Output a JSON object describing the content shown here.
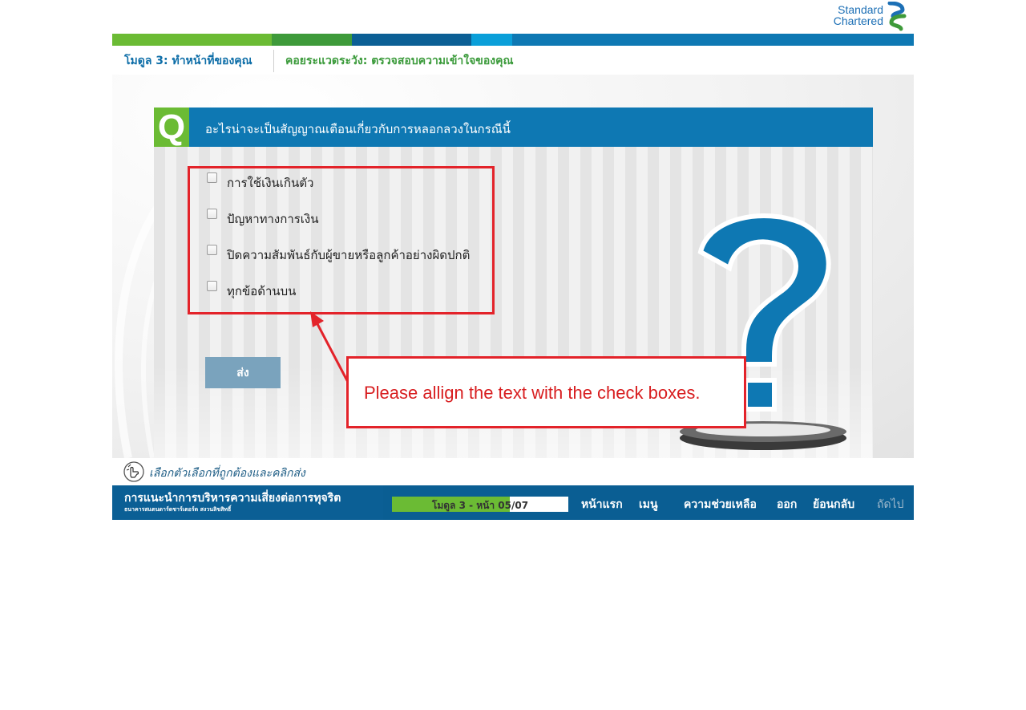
{
  "brand": {
    "line1": "Standard",
    "line2": "Chartered",
    "stripe_colors": [
      "#6bbb34",
      "#3e9a3a",
      "#0b5f95",
      "#0a9fd9",
      "#0e78b3"
    ]
  },
  "header": {
    "module_title": "โมดูล 3: ทำหน้าที่ของคุณ",
    "section_title": "คอยระแวดระวัง: ตรวจสอบความเข้าใจของคุณ"
  },
  "question": {
    "badge": "Q",
    "text": "อะไรน่าจะเป็นสัญญาณเตือนเกี่ยวกับการหลอกลวงในกรณีนี้",
    "options": [
      "การใช้เงินเกินตัว",
      "ปัญหาทางการเงิน",
      "ปิดความสัมพันธ์กับผู้ขายหรือลูกค้าอย่างผิดปกติ",
      "ทุกข้อด้านบน"
    ],
    "submit_label": "ส่ง"
  },
  "annotation": {
    "text": "Please allign the text with the check boxes."
  },
  "hint": {
    "text": "เลือกตัวเลือกที่ถูกต้องและคลิกส่ง"
  },
  "footer": {
    "course_title": "การแนะนำการบริหารความเสี่ยงต่อการทุจริต",
    "course_sub": "ธนาคารสแตนดาร์ดชาร์เตอร์ด สงวนลิขสิทธิ์",
    "progress_label": "โมดูล 3 - หน้า 05/07",
    "progress_fraction": 0.67,
    "nav": {
      "home": "หน้าแรก",
      "menu": "เมนู",
      "help": "ความช่วยเหลือ",
      "exit": "ออก",
      "back": "ย้อนกลับ",
      "next": "ถัดไป"
    }
  },
  "colors": {
    "accent_blue": "#0e78b3",
    "accent_green": "#6bbb34",
    "annotation_red": "#e3232a"
  }
}
